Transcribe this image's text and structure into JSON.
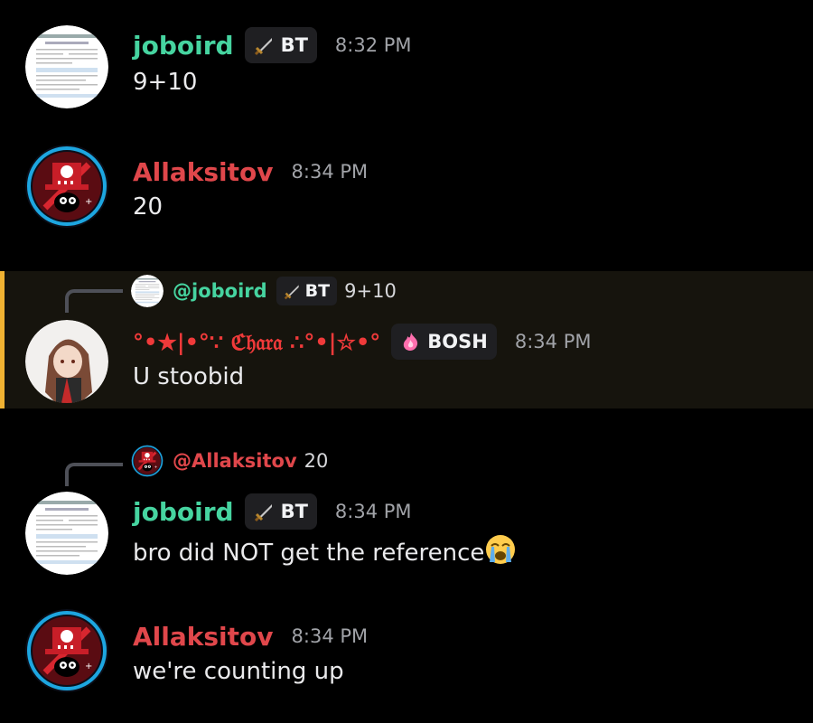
{
  "messages": [
    {
      "author": "joboird",
      "tag": "BT",
      "time": "8:32 PM",
      "text": "9+10"
    },
    {
      "author": "Allaksitov",
      "time": "8:34 PM",
      "text": "20"
    },
    {
      "reply": {
        "author": "@joboird",
        "tag": "BT",
        "text": "9+10"
      },
      "author": "°•★|•°∵ ℭ𝔥𝔞𝔯𝔞 ∴°•|☆•°",
      "tag": "BOSH",
      "time": "8:34 PM",
      "text": "U stoobid"
    },
    {
      "reply": {
        "author": "@Allaksitov",
        "text": "20"
      },
      "author": "joboird",
      "tag": "BT",
      "time": "8:34 PM",
      "text": "bro did NOT get the reference",
      "emoji": "loudly-crying-face"
    },
    {
      "author": "Allaksitov",
      "time": "8:34 PM",
      "text": "we're counting up"
    }
  ],
  "colors": {
    "green_name": "#46d4a0",
    "red_name": "#e0474b",
    "highlight_bar": "#f0b232",
    "timestamp": "#a1a3a8"
  },
  "icons": {
    "bt_tag": "sword-icon",
    "bosh_tag": "flame-icon"
  }
}
